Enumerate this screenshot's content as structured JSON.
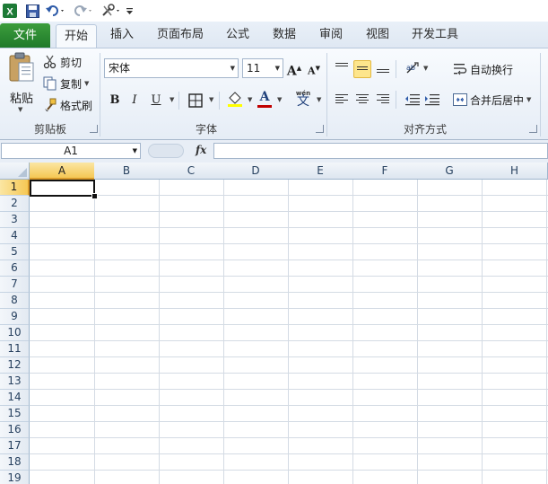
{
  "quick_access": {
    "icons": [
      "excel-logo-icon",
      "save-icon",
      "undo-icon",
      "redo-icon",
      "tools-icon",
      "customize-icon"
    ]
  },
  "tabs": [
    {
      "label": "文件",
      "active": false
    },
    {
      "label": "开始",
      "active": true
    },
    {
      "label": "插入",
      "active": false
    },
    {
      "label": "页面布局",
      "active": false
    },
    {
      "label": "公式",
      "active": false
    },
    {
      "label": "数据",
      "active": false
    },
    {
      "label": "审阅",
      "active": false
    },
    {
      "label": "视图",
      "active": false
    },
    {
      "label": "开发工具",
      "active": false
    }
  ],
  "clipboard": {
    "paste_label": "粘贴",
    "cut_label": "剪切",
    "copy_label": "复制",
    "format_painter_label": "格式刷",
    "group_label": "剪贴板"
  },
  "font": {
    "font_name": "宋体",
    "font_size": "11",
    "grow_label": "A",
    "shrink_label": "A",
    "bold_label": "B",
    "italic_label": "I",
    "underline_label": "U",
    "wen_label": "wén",
    "wen_char": "文",
    "font_color_label": "A",
    "font_color": "#c00000",
    "fill_color": "#ffff00",
    "group_label": "字体"
  },
  "alignment": {
    "wrap_text_label": "自动换行",
    "merge_center_label": "合并后居中",
    "group_label": "对齐方式",
    "active_vertical": "middle"
  },
  "formula_bar": {
    "name_box": "A1",
    "fx_label": "fx",
    "formula": ""
  },
  "grid": {
    "columns": [
      "A",
      "B",
      "C",
      "D",
      "E",
      "F",
      "G",
      "H"
    ],
    "rows": [
      "1",
      "2",
      "3",
      "4",
      "5",
      "6",
      "7",
      "8",
      "9",
      "10",
      "11",
      "12",
      "13",
      "14",
      "15",
      "16",
      "17",
      "18",
      "19"
    ],
    "selected_cell": "A1",
    "selected_column": "A",
    "selected_row": "1"
  },
  "colors": {
    "file_tab": "#217a2b",
    "selection_header": "#f5c854",
    "ribbon_bg": "#e6edf6"
  }
}
